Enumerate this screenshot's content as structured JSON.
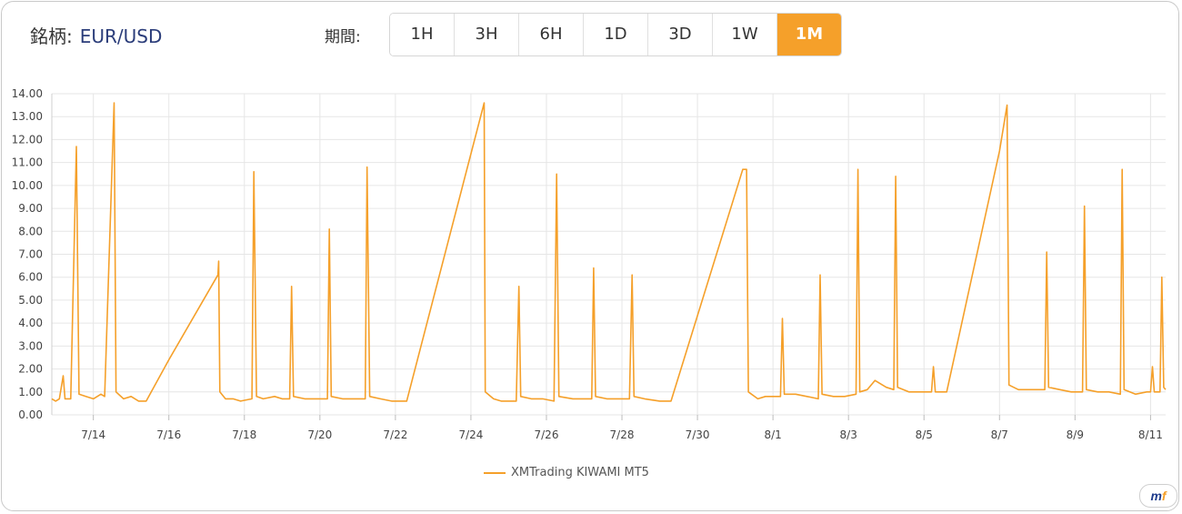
{
  "header": {
    "symbol_label": "銘柄:",
    "symbol_value": "EUR/USD",
    "period_label": "期間:",
    "periods": [
      "1H",
      "3H",
      "6H",
      "1D",
      "3D",
      "1W",
      "1M"
    ],
    "active_period": "1M"
  },
  "legend": {
    "series_name": "XMTrading KIWAMI MT5"
  },
  "logo": {
    "text_a": "m",
    "text_b": "f"
  },
  "colors": {
    "accent": "#f5a02a",
    "grid": "#e6e6e6",
    "axis": "#444444"
  },
  "chart_data": {
    "type": "line",
    "title": "",
    "xlabel": "",
    "ylabel": "",
    "ylim": [
      0,
      14
    ],
    "yticks": [
      "0.00",
      "1.00",
      "2.00",
      "3.00",
      "4.00",
      "5.00",
      "6.00",
      "7.00",
      "8.00",
      "9.00",
      "10.00",
      "11.00",
      "12.00",
      "13.00",
      "14.00"
    ],
    "xlim": [
      12.9,
      42.4
    ],
    "xtick_positions": [
      14,
      16,
      18,
      20,
      22,
      24,
      26,
      28,
      30,
      32,
      34,
      36,
      38,
      40,
      42
    ],
    "xtick_labels": [
      "7/14",
      "7/16",
      "7/18",
      "7/20",
      "7/22",
      "7/24",
      "7/26",
      "7/28",
      "7/30",
      "8/1",
      "8/3",
      "8/5",
      "8/7",
      "8/9",
      "8/11"
    ],
    "x_unit": "day (7/14 = 14, 8/1 = 32)",
    "grid": true,
    "legend_position": "bottom-center",
    "series": [
      {
        "name": "XMTrading KIWAMI MT5",
        "color": "#f5a02a",
        "points": [
          [
            12.9,
            0.7
          ],
          [
            13.0,
            0.6
          ],
          [
            13.1,
            0.7
          ],
          [
            13.2,
            1.7
          ],
          [
            13.25,
            0.7
          ],
          [
            13.4,
            0.7
          ],
          [
            13.55,
            11.7
          ],
          [
            13.62,
            0.9
          ],
          [
            13.8,
            0.8
          ],
          [
            14.0,
            0.7
          ],
          [
            14.2,
            0.9
          ],
          [
            14.3,
            0.8
          ],
          [
            14.55,
            13.6
          ],
          [
            14.6,
            1.0
          ],
          [
            14.8,
            0.7
          ],
          [
            15.0,
            0.8
          ],
          [
            15.2,
            0.6
          ],
          [
            15.4,
            0.6
          ],
          [
            16.0,
            2.4
          ],
          [
            17.3,
            6.1
          ],
          [
            17.32,
            6.7
          ],
          [
            17.35,
            1.0
          ],
          [
            17.5,
            0.7
          ],
          [
            17.7,
            0.7
          ],
          [
            17.9,
            0.6
          ],
          [
            18.2,
            0.7
          ],
          [
            18.25,
            10.6
          ],
          [
            18.32,
            0.8
          ],
          [
            18.5,
            0.7
          ],
          [
            18.8,
            0.8
          ],
          [
            19.0,
            0.7
          ],
          [
            19.2,
            0.7
          ],
          [
            19.25,
            5.6
          ],
          [
            19.3,
            0.8
          ],
          [
            19.6,
            0.7
          ],
          [
            19.8,
            0.7
          ],
          [
            20.2,
            0.7
          ],
          [
            20.25,
            8.1
          ],
          [
            20.3,
            0.8
          ],
          [
            20.6,
            0.7
          ],
          [
            20.9,
            0.7
          ],
          [
            21.2,
            0.7
          ],
          [
            21.25,
            10.8
          ],
          [
            21.32,
            0.8
          ],
          [
            21.6,
            0.7
          ],
          [
            21.9,
            0.6
          ],
          [
            22.3,
            0.6
          ],
          [
            24.35,
            13.6
          ],
          [
            24.38,
            1.0
          ],
          [
            24.6,
            0.7
          ],
          [
            24.8,
            0.6
          ],
          [
            25.2,
            0.6
          ],
          [
            25.27,
            5.6
          ],
          [
            25.32,
            0.8
          ],
          [
            25.6,
            0.7
          ],
          [
            25.9,
            0.7
          ],
          [
            26.2,
            0.6
          ],
          [
            26.27,
            10.5
          ],
          [
            26.33,
            0.8
          ],
          [
            26.7,
            0.7
          ],
          [
            27.0,
            0.7
          ],
          [
            27.2,
            0.7
          ],
          [
            27.25,
            6.4
          ],
          [
            27.3,
            0.8
          ],
          [
            27.6,
            0.7
          ],
          [
            27.8,
            0.7
          ],
          [
            28.2,
            0.7
          ],
          [
            28.27,
            6.1
          ],
          [
            28.32,
            0.8
          ],
          [
            28.6,
            0.7
          ],
          [
            29.0,
            0.6
          ],
          [
            29.3,
            0.6
          ],
          [
            31.2,
            10.7
          ],
          [
            31.3,
            10.7
          ],
          [
            31.35,
            1.0
          ],
          [
            31.6,
            0.7
          ],
          [
            31.8,
            0.8
          ],
          [
            32.0,
            0.8
          ],
          [
            32.2,
            0.8
          ],
          [
            32.25,
            4.2
          ],
          [
            32.3,
            0.9
          ],
          [
            32.6,
            0.9
          ],
          [
            32.9,
            0.8
          ],
          [
            33.2,
            0.7
          ],
          [
            33.25,
            6.1
          ],
          [
            33.3,
            0.9
          ],
          [
            33.6,
            0.8
          ],
          [
            33.9,
            0.8
          ],
          [
            34.2,
            0.9
          ],
          [
            34.25,
            10.7
          ],
          [
            34.3,
            1.0
          ],
          [
            34.5,
            1.1
          ],
          [
            34.7,
            1.5
          ],
          [
            35.0,
            1.2
          ],
          [
            35.2,
            1.1
          ],
          [
            35.25,
            10.4
          ],
          [
            35.3,
            1.2
          ],
          [
            35.6,
            1.0
          ],
          [
            35.9,
            1.0
          ],
          [
            36.2,
            1.0
          ],
          [
            36.25,
            2.1
          ],
          [
            36.3,
            1.0
          ],
          [
            36.6,
            1.0
          ],
          [
            38.0,
            11.5
          ],
          [
            38.2,
            13.5
          ],
          [
            38.25,
            1.3
          ],
          [
            38.5,
            1.1
          ],
          [
            38.8,
            1.1
          ],
          [
            39.1,
            1.1
          ],
          [
            39.2,
            1.1
          ],
          [
            39.25,
            7.1
          ],
          [
            39.3,
            1.2
          ],
          [
            39.6,
            1.1
          ],
          [
            39.9,
            1.0
          ],
          [
            40.2,
            1.0
          ],
          [
            40.25,
            9.1
          ],
          [
            40.3,
            1.1
          ],
          [
            40.6,
            1.0
          ],
          [
            40.9,
            1.0
          ],
          [
            41.2,
            0.9
          ],
          [
            41.25,
            10.7
          ],
          [
            41.3,
            1.1
          ],
          [
            41.6,
            0.9
          ],
          [
            41.9,
            1.0
          ],
          [
            42.0,
            1.0
          ],
          [
            42.05,
            2.1
          ],
          [
            42.1,
            1.0
          ],
          [
            42.25,
            1.0
          ],
          [
            42.3,
            6.0
          ],
          [
            42.35,
            1.2
          ],
          [
            42.4,
            1.1
          ]
        ]
      }
    ]
  }
}
